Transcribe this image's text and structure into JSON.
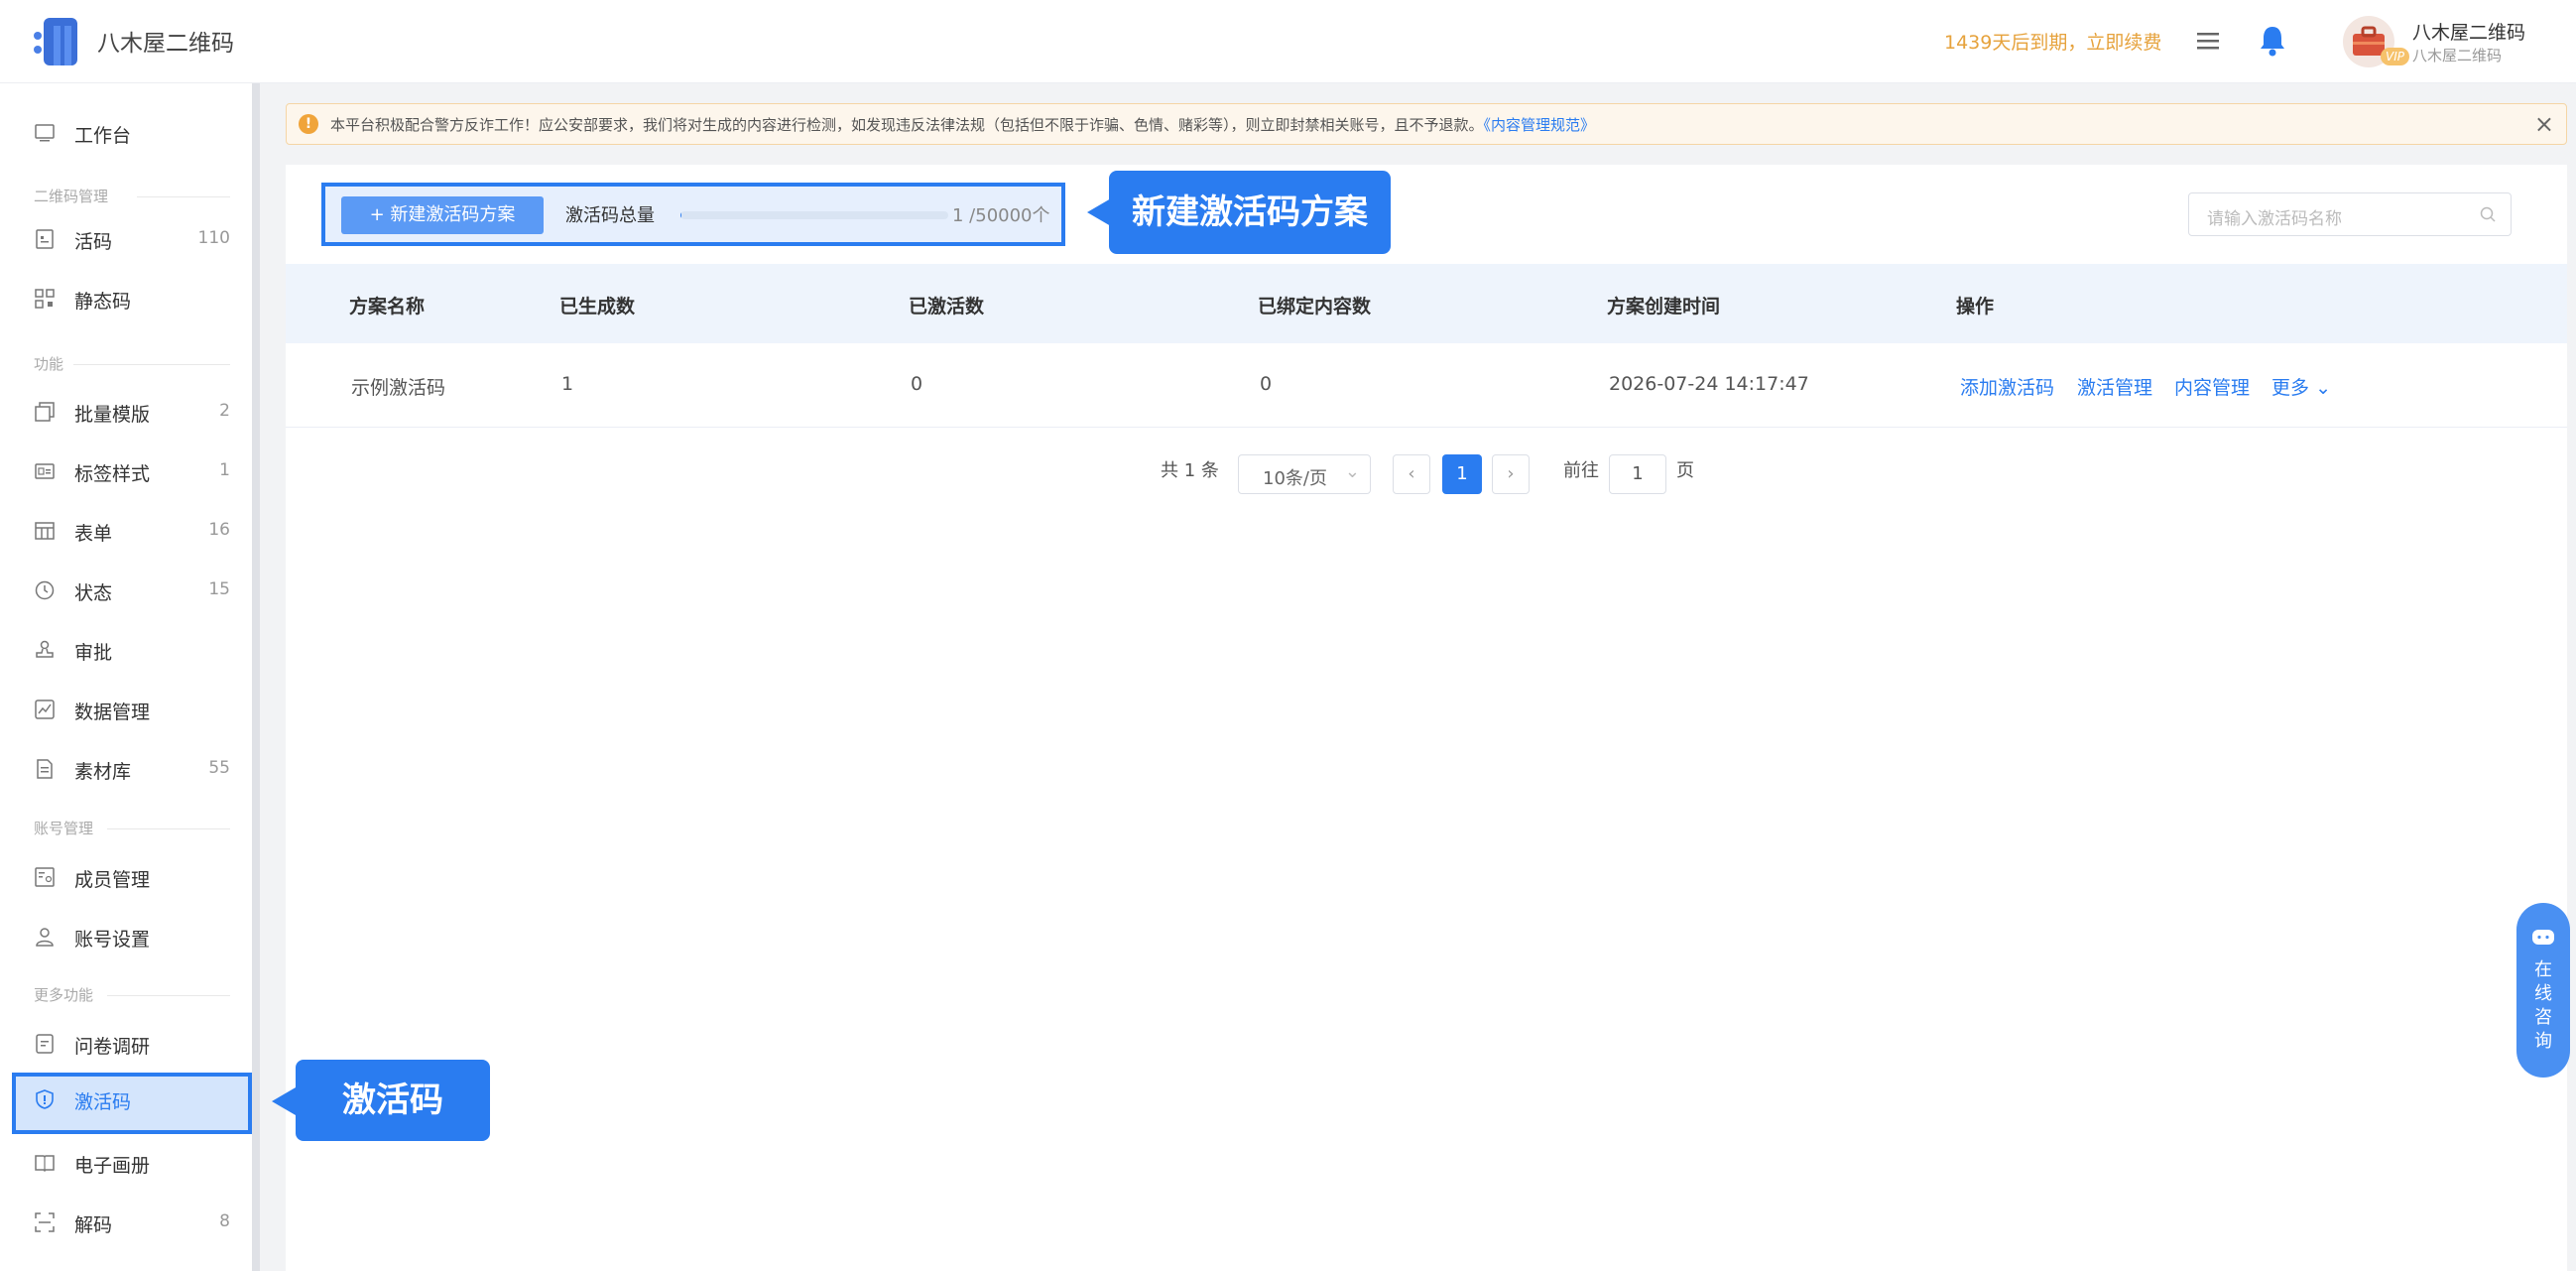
{
  "header": {
    "app_title": "八木屋二维码",
    "expire_text": "1439天后到期，立即续费",
    "user_name": "八木屋二维码",
    "user_sub": "八木屋二维码",
    "vip_badge": "VIP"
  },
  "sidebar": {
    "workbench": "工作台",
    "sections": {
      "qrcode": "二维码管理",
      "features": "功能",
      "account": "账号管理",
      "more": "更多功能"
    },
    "items": {
      "huoma": {
        "label": "活码",
        "count": "110",
        "icon": "file-code-icon"
      },
      "static": {
        "label": "静态码",
        "icon": "qrcode-icon"
      },
      "batch": {
        "label": "批量模版",
        "count": "2",
        "icon": "copy-icon"
      },
      "label_style": {
        "label": "标签样式",
        "count": "1",
        "icon": "label-icon"
      },
      "form": {
        "label": "表单",
        "count": "16",
        "icon": "table-icon"
      },
      "status": {
        "label": "状态",
        "count": "15",
        "icon": "clock-icon"
      },
      "approval": {
        "label": "审批",
        "icon": "stamp-icon"
      },
      "data": {
        "label": "数据管理",
        "icon": "chart-icon"
      },
      "material": {
        "label": "素材库",
        "count": "55",
        "icon": "document-icon"
      },
      "members": {
        "label": "成员管理",
        "icon": "member-card-icon"
      },
      "account_settings": {
        "label": "账号设置",
        "icon": "user-icon"
      },
      "survey": {
        "label": "问卷调研",
        "icon": "survey-icon"
      },
      "activation": {
        "label": "激活码",
        "icon": "shield-icon"
      },
      "album": {
        "label": "电子画册",
        "icon": "book-icon"
      },
      "decode": {
        "label": "解码",
        "count": "8",
        "icon": "scan-icon"
      }
    }
  },
  "notice": {
    "text": "本平台积极配合警方反诈工作！应公安部要求，我们将对生成的内容进行检测，如发现违反法律法规（包括但不限于诈骗、色情、赌彩等），则立即封禁相关账号，且不予退款。",
    "link": "《内容管理规范》"
  },
  "toolbar": {
    "new_button": "+ 新建激活码方案",
    "total_label": "激活码总量",
    "total_value": "1 /50000个",
    "total_fraction": 2e-05,
    "search_placeholder": "请输入激活码名称"
  },
  "table": {
    "headers": [
      "方案名称",
      "已生成数",
      "已激活数",
      "已绑定内容数",
      "方案创建时间",
      "操作"
    ],
    "rows": [
      {
        "name": "示例激活码",
        "generated": "1",
        "activated": "0",
        "bound": "0",
        "created": "2026-07-24 14:17:47",
        "ops": [
          "添加激活码",
          "激活管理",
          "内容管理",
          "更多"
        ]
      }
    ]
  },
  "pagination": {
    "total": "共 1 条",
    "page_size": "10条/页",
    "current": "1",
    "goto_prefix": "前往",
    "goto_value": "1",
    "goto_suffix": "页"
  },
  "callouts": {
    "new_scheme": "新建激活码方案",
    "activation": "激活码"
  },
  "consult": {
    "text": "在线咨询"
  },
  "colors": {
    "accent": "#2a7cf0",
    "warning": "#e6a23c",
    "notice_bg": "#fdf6ec"
  }
}
